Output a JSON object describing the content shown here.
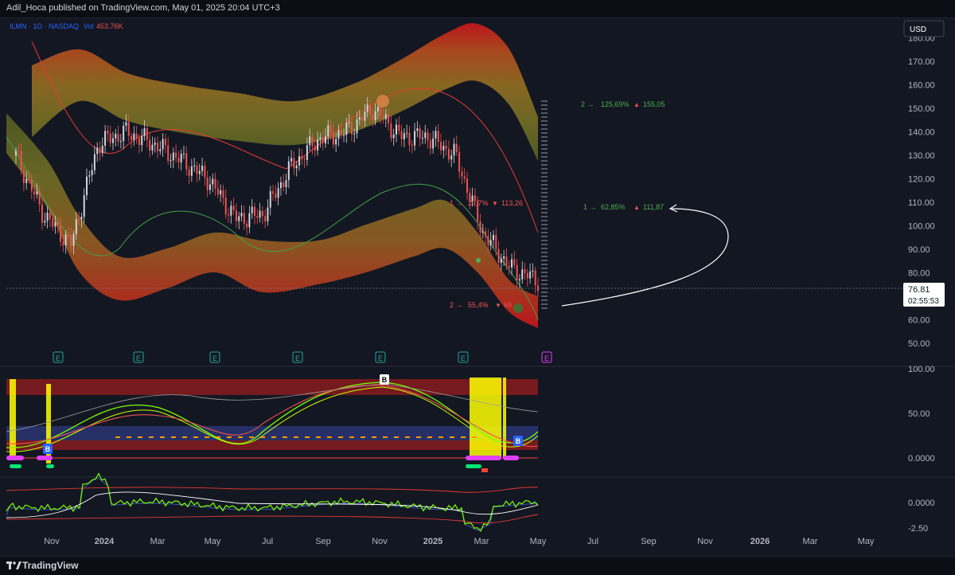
{
  "header": {
    "published": "Adil_Hoca published on TradingView.com, May 01, 2025 20:04 UTC+3"
  },
  "footer": {
    "brand": "TradingView",
    "logo_icon": "tradingview-logo-icon"
  },
  "legend": {
    "symbol": "ILMN · 1D · NASDAQ",
    "vol_label": "Vol",
    "vol_value": "453.76K"
  },
  "currency": "USD",
  "last_price": {
    "value": "76.81",
    "countdown": "02:55:53"
  },
  "annotations": {
    "t2_up": {
      "arrow": "2 →",
      "pct": "125,69%",
      "tri": "▲",
      "price": "155,05"
    },
    "t1_up": {
      "arrow": "1 →",
      "pct": "62,85%",
      "tri": "▲",
      "price": "111,87"
    },
    "t1_dn": {
      "arrow": "1 →",
      "pct": "27,7%",
      "tri": "▼",
      "price": "113,26"
    },
    "t2_dn": {
      "arrow": "2 →",
      "pct": "55,4%",
      "tri": "▼",
      "price": "69"
    }
  },
  "earnings_marker": "E",
  "signal_marker": "B",
  "colors": {
    "bg": "#131722",
    "up": "#26a69a",
    "down": "#ef5350",
    "candle_up": "#d1d4dc",
    "candle_down": "#ef5350",
    "green_text": "#4caf50",
    "red_text": "#ef5350"
  },
  "chart_data": [
    {
      "type": "line",
      "title": "ILMN · 1D · NASDAQ",
      "y_ticks": [
        "180.00",
        "170.00",
        "160.00",
        "150.00",
        "140.00",
        "130.00",
        "120.00",
        "110.00",
        "100.00",
        "90.00",
        "80.00",
        "70.00",
        "60.00",
        "50.00"
      ],
      "x_ticks": [
        "Nov",
        "2024",
        "Mar",
        "May",
        "Jul",
        "Sep",
        "Nov",
        "2025",
        "Mar",
        "May",
        "Jul",
        "Sep",
        "Nov",
        "2026",
        "Mar",
        "May"
      ],
      "ylim": [
        45,
        185
      ],
      "grid": false,
      "series": [
        {
          "name": "ILMN",
          "x": [
            "Oct",
            "Nov",
            "Dec",
            "2024",
            "Feb",
            "Mar",
            "Apr",
            "May",
            "Jun",
            "Jul",
            "Aug",
            "Sep",
            "Oct",
            "Nov",
            "Dec",
            "2025",
            "Feb",
            "Mar",
            "Apr",
            "May"
          ],
          "values": [
            130,
            105,
            92,
            135,
            140,
            135,
            128,
            120,
            103,
            105,
            125,
            137,
            140,
            150,
            138,
            138,
            130,
            97,
            82,
            76.81
          ]
        }
      ]
    },
    {
      "type": "line",
      "y_ticks": [
        "100.00",
        "50.00",
        "0.0000"
      ],
      "ylim": [
        -10,
        105
      ]
    },
    {
      "type": "line",
      "y_ticks": [
        "0.0000",
        "-2.50"
      ],
      "ylim": [
        -3.5,
        2.5
      ]
    }
  ]
}
